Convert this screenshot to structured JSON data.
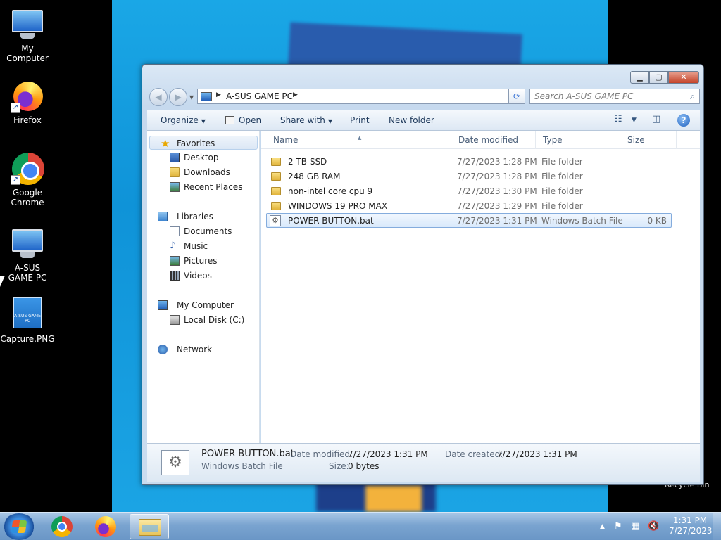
{
  "desktop": {
    "icons": [
      {
        "label": "My Computer"
      },
      {
        "label": "Firefox"
      },
      {
        "label": "Google Chrome"
      },
      {
        "label": "A-SUS GAME PC"
      },
      {
        "label": "Capture.PNG",
        "thumb_text": "A-SUS GAME PC"
      }
    ],
    "recycle_bin_label": "Recycle Bin"
  },
  "window": {
    "address": {
      "crumb": "A-SUS GAME PC"
    },
    "search": {
      "placeholder": "Search A-SUS GAME PC"
    },
    "toolbar": {
      "organize": "Organize",
      "open": "Open",
      "share_with": "Share with",
      "print": "Print",
      "new_folder": "New folder"
    },
    "nav": {
      "favorites": "Favorites",
      "desktop": "Desktop",
      "downloads": "Downloads",
      "recent_places": "Recent Places",
      "libraries": "Libraries",
      "documents": "Documents",
      "music": "Music",
      "pictures": "Pictures",
      "videos": "Videos",
      "my_computer": "My Computer",
      "local_disk": "Local Disk (C:)",
      "network": "Network"
    },
    "columns": {
      "name": "Name",
      "date_modified": "Date modified",
      "type": "Type",
      "size": "Size"
    },
    "files": [
      {
        "name": "2 TB SSD",
        "date": "7/27/2023 1:28 PM",
        "type": "File folder",
        "size": ""
      },
      {
        "name": "248 GB RAM",
        "date": "7/27/2023 1:28 PM",
        "type": "File folder",
        "size": ""
      },
      {
        "name": "non-intel core cpu 9",
        "date": "7/27/2023 1:30 PM",
        "type": "File folder",
        "size": ""
      },
      {
        "name": "WINDOWS 19 PRO MAX",
        "date": "7/27/2023 1:29 PM",
        "type": "File folder",
        "size": ""
      },
      {
        "name": "POWER BUTTON.bat",
        "date": "7/27/2023 1:31 PM",
        "type": "Windows Batch File",
        "size": "0 KB"
      }
    ],
    "details": {
      "filename": "POWER BUTTON.bat",
      "filetype": "Windows Batch File",
      "date_modified_label": "Date modified:",
      "date_modified": "7/27/2023 1:31 PM",
      "date_created_label": "Date created:",
      "date_created": "7/27/2023 1:31 PM",
      "size_label": "Size:",
      "size": "0 bytes"
    }
  },
  "taskbar": {
    "clock_time": "1:31 PM",
    "clock_date": "7/27/2023"
  }
}
